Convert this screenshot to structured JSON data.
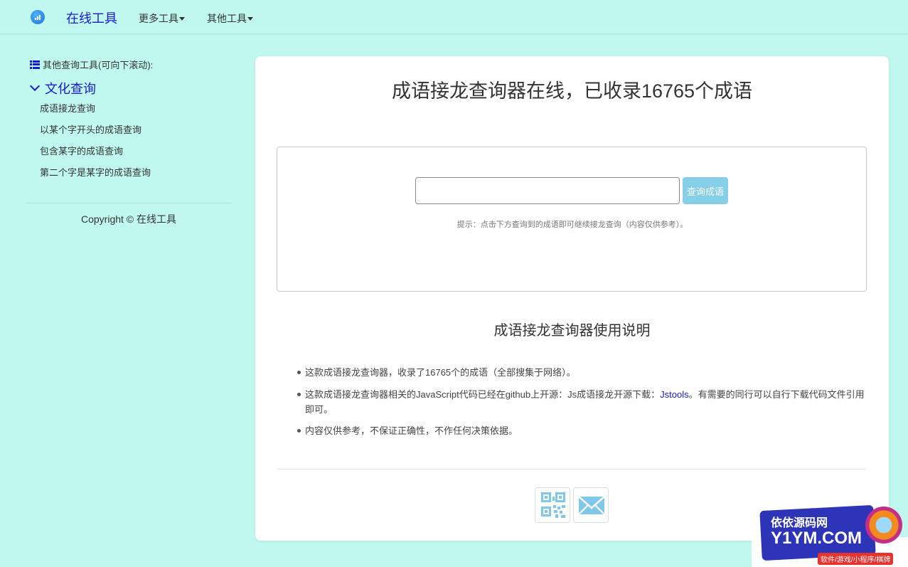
{
  "navbar": {
    "brand": "在线工具",
    "menu": [
      {
        "label": "更多工具"
      },
      {
        "label": "其他工具"
      }
    ]
  },
  "sidebar": {
    "heading": "其他查询工具(可向下滚动):",
    "category": "文化查询",
    "links": [
      {
        "label": "成语接龙查询"
      },
      {
        "label": "以某个字开头的成语查询"
      },
      {
        "label": "包含某字的成语查询"
      },
      {
        "label": "第二个字是某字的成语查询"
      }
    ],
    "copyright": "Copyright © 在线工具"
  },
  "main": {
    "title": "成语接龙查询器在线，已收录16765个成语",
    "search": {
      "value": "",
      "placeholder": "",
      "button_label": "查询成语",
      "hint": "提示：点击下方查询到的成语即可继续接龙查询（内容仅供参考）。"
    },
    "usage": {
      "title": "成语接龙查询器使用说明",
      "item1": "这款成语接龙查询器，收录了16765个的成语（全部搜集于网络）。",
      "item2_before": "这款成语接龙查询器相关的JavaScript代码已经在github上开源：Js成语接龙开源下载：",
      "item2_link": "Jstools",
      "item2_after": "。有需要的同行可以自行下载代码文件引用即可。",
      "item3": "内容仅供参考，不保证正确性，不作任何决策依据。"
    },
    "share": [
      {
        "icon": "qr-code-icon"
      },
      {
        "icon": "mail-icon"
      }
    ]
  },
  "watermark": {
    "line1": "依依源码网",
    "line2": "Y1YM.COM",
    "line3": "软件/游戏/小程序/棋牌"
  },
  "colors": {
    "background": "#c0f8ef",
    "brand": "#1a1acd",
    "button": "#86cfe9",
    "card": "#ffffff"
  }
}
